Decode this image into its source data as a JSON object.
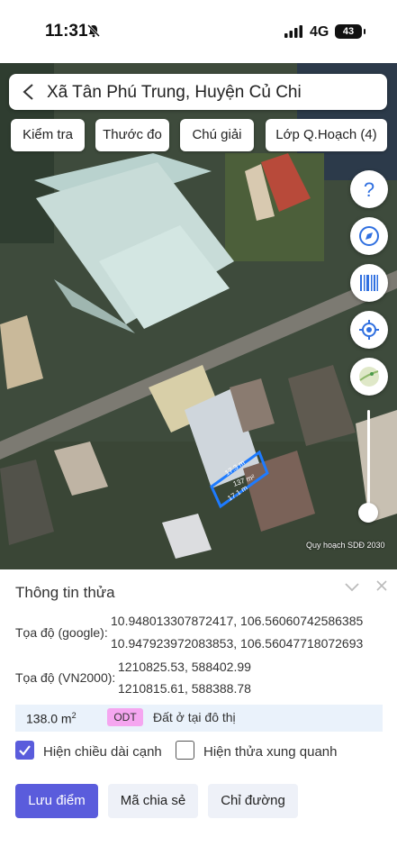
{
  "status": {
    "time": "11:31",
    "network": "4G",
    "battery": "43"
  },
  "map": {
    "search_title": "Xã Tân Phú Trung, Huyện Củ Chi",
    "chips": [
      "Kiểm tra",
      "Thước đo",
      "Chú giải",
      "Lớp Q.Hoạch (4)"
    ],
    "parcel_labels": {
      "edge_top": "17.3 m",
      "area": "137 m²",
      "edge_bottom": "17.1 m"
    },
    "credit": "Quy hoạch SDĐ 2030",
    "layer_opacity_level": 0.1,
    "colors": {
      "parcel_outline": "#1e7bff"
    }
  },
  "panel": {
    "title": "Thông tin thửa",
    "google_label": "Tọa độ (google):",
    "google_coords": [
      "10.948013307872417, 106.56060742586385",
      "10.947923972083853, 106.56047718072693"
    ],
    "vn2000_label": "Tọa độ (VN2000):",
    "vn2000_coords": [
      "1210825.53, 588402.99",
      "1210815.61, 588388.78"
    ],
    "area_value": "138.0 m",
    "area_unit_sup": "2",
    "zone_code": "ODT",
    "land_type": "Đất ở tại đô thị",
    "check_edges_label": "Hiện chiều dài cạnh",
    "check_edges_checked": true,
    "check_neighbors_label": "Hiện thửa xung quanh",
    "check_neighbors_checked": false,
    "buttons": {
      "save": "Lưu điểm",
      "share": "Mã chia sẻ",
      "directions": "Chỉ đường"
    },
    "colors": {
      "accent": "#5a5cdc",
      "zone_badge": "#f5a6f0"
    }
  }
}
